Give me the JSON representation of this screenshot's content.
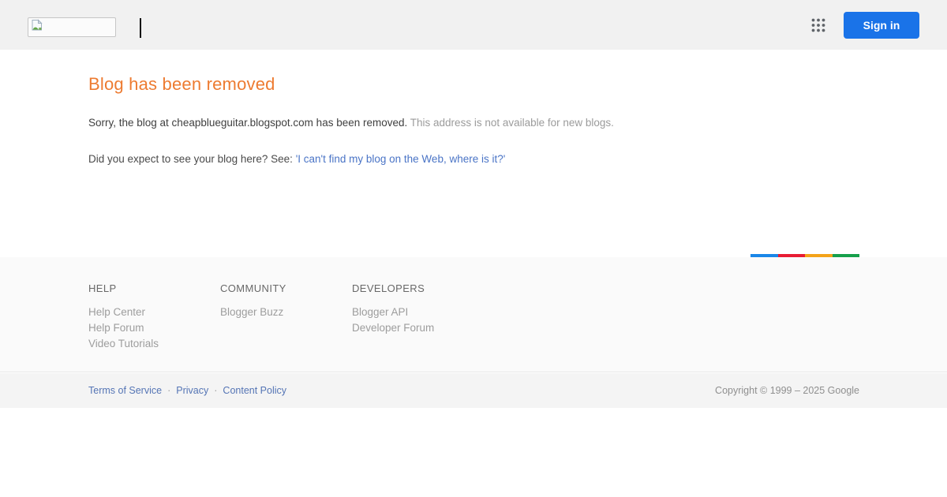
{
  "header": {
    "sign_in_label": "Sign in",
    "logo_icon": "broken-image",
    "apps_icon": "google-apps-grid",
    "accent_blue": "#1a73e8"
  },
  "main": {
    "title": "Blog has been removed",
    "title_color": "#ed7b31",
    "message_primary": "Sorry, the blog at cheapblueguitar.blogspot.com has been removed.",
    "message_secondary": "This address is not available for new blogs.",
    "help_prompt": "Did you expect to see your blog here? See:",
    "help_link_label": "'I can't find my blog on the Web, where is it?'"
  },
  "google_bar": {
    "colors": [
      "#1a87e8",
      "#e81c33",
      "#f4a319",
      "#16a04b"
    ]
  },
  "footer": {
    "columns": [
      {
        "title": "HELP",
        "links": [
          "Help Center",
          "Help Forum",
          "Video Tutorials"
        ]
      },
      {
        "title": "COMMUNITY",
        "links": [
          "Blogger Buzz"
        ]
      },
      {
        "title": "DEVELOPERS",
        "links": [
          "Blogger API",
          "Developer Forum"
        ]
      }
    ]
  },
  "legal": {
    "links": [
      "Terms of Service",
      "Privacy",
      "Content Policy"
    ],
    "separator": "·",
    "copyright": "Copyright © 1999 – 2025 Google"
  }
}
